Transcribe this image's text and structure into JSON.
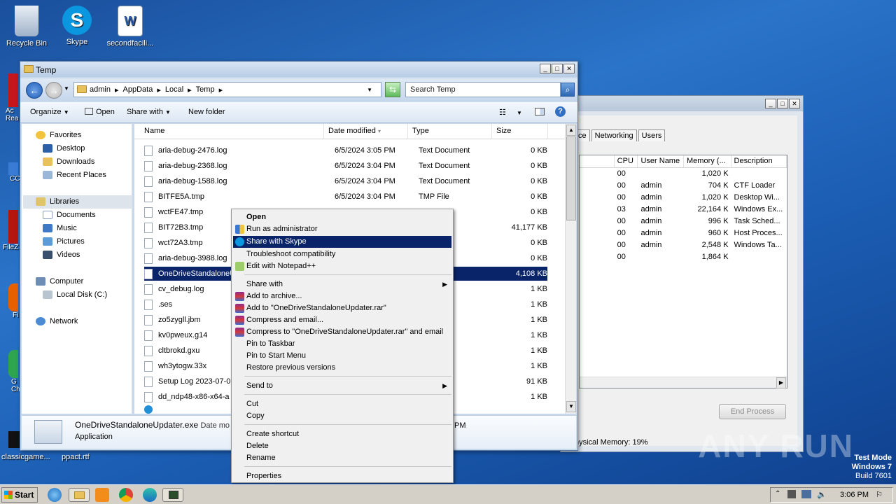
{
  "desktop": {
    "icons": [
      {
        "label": "Recycle Bin",
        "icon": "recycle-bin-icon"
      },
      {
        "label": "Skype",
        "icon": "skype-icon"
      },
      {
        "label": "secondfacili...",
        "icon": "word-document-icon"
      }
    ],
    "left_partial": [
      "Ac Rea",
      "CC",
      "FileZ",
      "Fi",
      "G Ch"
    ],
    "bottom_labels": [
      "classicgame...",
      "ppact.rtf"
    ]
  },
  "explorer": {
    "title": "Temp",
    "breadcrumb": [
      "admin",
      "AppData",
      "Local",
      "Temp"
    ],
    "search_placeholder": "Search Temp",
    "toolbar": {
      "organize": "Organize",
      "open": "Open",
      "share_with": "Share with",
      "new_folder": "New folder"
    },
    "nav": {
      "favorites": "Favorites",
      "desktop": "Desktop",
      "downloads": "Downloads",
      "recent_places": "Recent Places",
      "libraries": "Libraries",
      "documents": "Documents",
      "music": "Music",
      "pictures": "Pictures",
      "videos": "Videos",
      "computer": "Computer",
      "local_disk": "Local Disk (C:)",
      "network": "Network"
    },
    "columns": {
      "name": "Name",
      "date": "Date modified",
      "type": "Type",
      "size": "Size"
    },
    "files": [
      {
        "name": "aria-debug-2476.log",
        "date": "6/5/2024 3:05 PM",
        "type": "Text Document",
        "size": "0 KB"
      },
      {
        "name": "aria-debug-2368.log",
        "date": "6/5/2024 3:04 PM",
        "type": "Text Document",
        "size": "0 KB"
      },
      {
        "name": "aria-debug-1588.log",
        "date": "6/5/2024 3:04 PM",
        "type": "Text Document",
        "size": "0 KB"
      },
      {
        "name": "BITFE5A.tmp",
        "date": "6/5/2024 3:04 PM",
        "type": "TMP File",
        "size": "0 KB"
      },
      {
        "name": "wctFE47.tmp",
        "date": "",
        "type": "",
        "size": "0 KB"
      },
      {
        "name": "BIT72B3.tmp",
        "date": "",
        "type": "",
        "size": "41,177 KB"
      },
      {
        "name": "wct72A3.tmp",
        "date": "",
        "type": "",
        "size": "0 KB"
      },
      {
        "name": "aria-debug-3988.log",
        "date": "",
        "type": "ent",
        "size": "0 KB"
      },
      {
        "name": "OneDriveStandaloneU",
        "date": "",
        "type": "",
        "size": "4,108 KB"
      },
      {
        "name": "cv_debug.log",
        "date": "",
        "type": "ent",
        "size": "1 KB"
      },
      {
        "name": ".ses",
        "date": "",
        "type": "",
        "size": "1 KB"
      },
      {
        "name": "zo5zygll.jbm",
        "date": "",
        "type": "",
        "size": "1 KB"
      },
      {
        "name": "kv0pweux.g14",
        "date": "",
        "type": "",
        "size": "1 KB"
      },
      {
        "name": "cltbrokd.gxu",
        "date": "",
        "type": "",
        "size": "1 KB"
      },
      {
        "name": "wh3ytogw.33x",
        "date": "",
        "type": "",
        "size": "1 KB"
      },
      {
        "name": "Setup Log 2023-07-0",
        "date": "",
        "type": "ent",
        "size": "91 KB"
      },
      {
        "name": "dd_ndp48-x86-x64-a",
        "date": "",
        "type": "ent",
        "size": "1 KB"
      }
    ],
    "details": {
      "filename": "OneDriveStandaloneUpdater.exe",
      "date_label": "Date mo",
      "kind": "Application",
      "time_fragment": "PM"
    }
  },
  "context_menu": {
    "items": [
      {
        "label": "Open",
        "bold": true
      },
      {
        "label": "Run as administrator",
        "icon": "shield-icon"
      },
      {
        "label": "Share with Skype",
        "icon": "skype-icon",
        "selected": true
      },
      {
        "label": "Troubleshoot compatibility"
      },
      {
        "label": "Edit with Notepad++",
        "icon": "notepadpp-icon"
      },
      {
        "label": "Share with",
        "submenu": true
      },
      {
        "label": "Add to archive...",
        "icon": "winrar-icon"
      },
      {
        "label": "Add to \"OneDriveStandaloneUpdater.rar\"",
        "icon": "winrar-icon"
      },
      {
        "label": "Compress and email...",
        "icon": "winrar-icon"
      },
      {
        "label": "Compress to \"OneDriveStandaloneUpdater.rar\" and email",
        "icon": "winrar-icon"
      },
      {
        "label": "Pin to Taskbar"
      },
      {
        "label": "Pin to Start Menu"
      },
      {
        "label": "Restore previous versions"
      },
      {
        "label": "Send to",
        "submenu": true
      },
      {
        "label": "Cut"
      },
      {
        "label": "Copy"
      },
      {
        "label": "Create shortcut"
      },
      {
        "label": "Delete"
      },
      {
        "label": "Rename"
      },
      {
        "label": "Properties"
      }
    ]
  },
  "taskmgr": {
    "tabs": [
      "ce",
      "Networking",
      "Users"
    ],
    "columns": [
      "CPU",
      "User Name",
      "Memory (...",
      "Description"
    ],
    "rows": [
      {
        "cpu": "00",
        "user": "",
        "mem": "1,020 K",
        "desc": ""
      },
      {
        "cpu": "00",
        "user": "admin",
        "mem": "704 K",
        "desc": "CTF Loader"
      },
      {
        "cpu": "00",
        "user": "admin",
        "mem": "1,020 K",
        "desc": "Desktop Wi..."
      },
      {
        "cpu": "03",
        "user": "admin",
        "mem": "22,164 K",
        "desc": "Windows Ex..."
      },
      {
        "cpu": "00",
        "user": "admin",
        "mem": "996 K",
        "desc": "Task Sched..."
      },
      {
        "cpu": "00",
        "user": "admin",
        "mem": "960 K",
        "desc": "Host Proces..."
      },
      {
        "cpu": "00",
        "user": "admin",
        "mem": "2,548 K",
        "desc": "Windows Ta..."
      },
      {
        "cpu": "00",
        "user": "",
        "mem": "1,864 K",
        "desc": ""
      }
    ],
    "end_process": "End Process",
    "status": "hysical Memory: 19%"
  },
  "taskbar": {
    "start": "Start",
    "clock": "3:06 PM"
  },
  "overlay": {
    "watermark": "ANY RUN",
    "test_mode": "Test Mode",
    "os": "Windows 7",
    "build": "Build 7601"
  }
}
